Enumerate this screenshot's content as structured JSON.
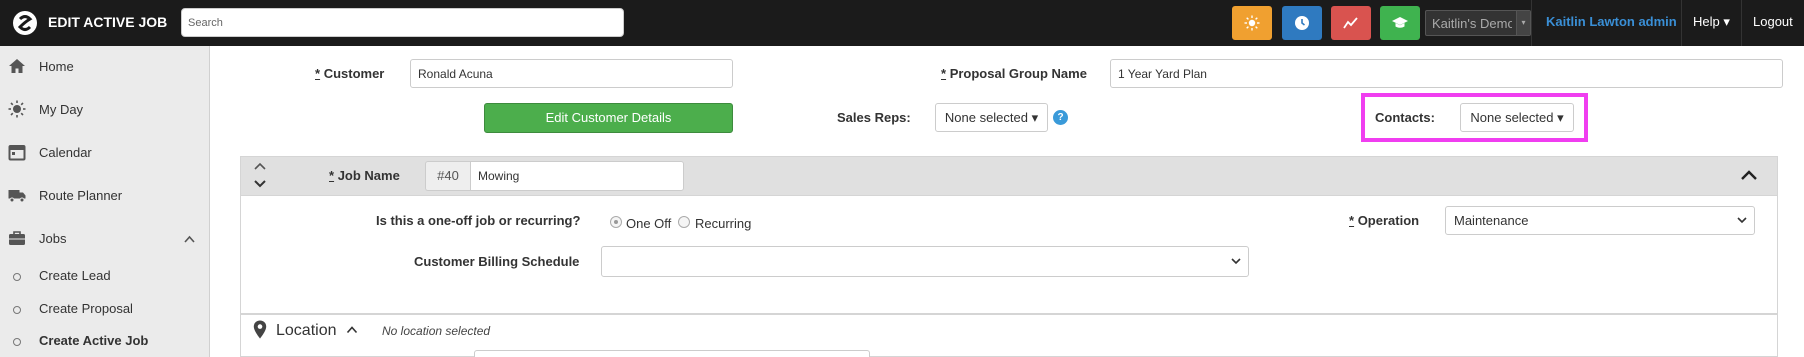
{
  "topbar": {
    "title": "EDIT ACTIVE JOB",
    "search_placeholder": "Search",
    "company": "Kaitlin's Demo",
    "user": "Kaitlin Lawton admin",
    "help": "Help ▾",
    "logout": "Logout"
  },
  "sidebar": {
    "items": [
      {
        "label": "Home",
        "icon": "home-icon"
      },
      {
        "label": "My Day",
        "icon": "sun-icon"
      },
      {
        "label": "Calendar",
        "icon": "calendar-icon"
      },
      {
        "label": "Route Planner",
        "icon": "truck-icon"
      },
      {
        "label": "Jobs",
        "icon": "briefcase-icon"
      }
    ],
    "sub_items": [
      "Create Lead",
      "Create Proposal",
      "Create Active Job"
    ]
  },
  "form": {
    "customer_label": "Customer",
    "customer_value": "Ronald Acuna",
    "proposal_group_label": "Proposal Group Name",
    "proposal_group_value": "1 Year Yard Plan",
    "edit_customer_button": "Edit Customer Details",
    "sales_reps_label": "Sales Reps:",
    "sales_reps_value": "None selected ▾",
    "contacts_label": "Contacts:",
    "contacts_value": "None selected ▾",
    "required_mark": "*",
    "help_glyph": "?"
  },
  "job": {
    "job_name_label": "Job Name",
    "job_number": "#40",
    "job_name_value": "Mowing",
    "recurring_question": "Is this a one-off job or recurring?",
    "option_one_off": "One Off",
    "option_recurring": "Recurring",
    "selected_option": "One Off",
    "operation_label": "Operation",
    "operation_value": "Maintenance",
    "billing_schedule_label": "Customer Billing Schedule",
    "billing_schedule_value": ""
  },
  "location": {
    "title": "Location",
    "status": "No location selected"
  },
  "colors": {
    "topbar": "#1b1b1b",
    "accent_link": "#3a8fd6",
    "green_button": "#4cae4c",
    "highlight": "#f03ef0",
    "quick_orange": "#f0a030",
    "quick_blue": "#2f7ac0",
    "quick_red": "#d9534f",
    "quick_green": "#3fb34f"
  }
}
